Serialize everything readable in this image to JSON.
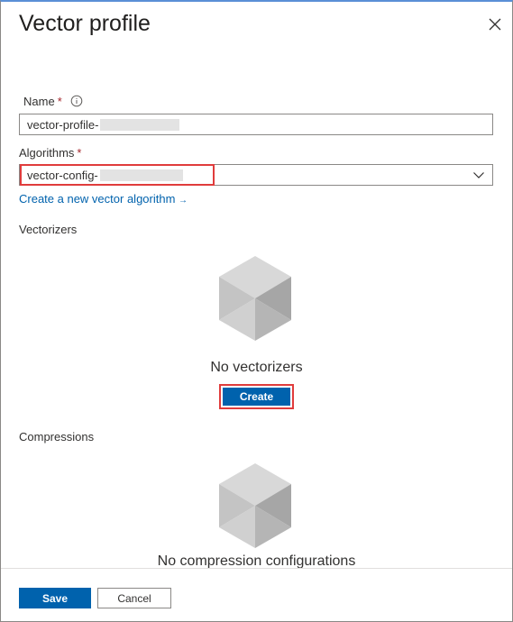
{
  "panel": {
    "title": "Vector profile",
    "close_icon": "close-icon"
  },
  "name_field": {
    "label": "Name",
    "required_mark": "*",
    "info_icon": "info-icon",
    "value": "vector-profile-"
  },
  "algorithms_field": {
    "label": "Algorithms",
    "required_mark": "*",
    "value": "vector-config-",
    "dropdown_icon": "chevron-down-icon"
  },
  "create_algorithm_link": {
    "label": "Create a new vector algorithm",
    "arrow": "→"
  },
  "vectorizers": {
    "section_label": "Vectorizers",
    "empty_icon": "cube-icon",
    "empty_text": "No vectorizers",
    "create_label": "Create"
  },
  "compressions": {
    "section_label": "Compressions",
    "empty_icon": "cube-icon",
    "empty_text": "No compression configurations"
  },
  "footer": {
    "save_label": "Save",
    "cancel_label": "Cancel"
  },
  "colors": {
    "accent": "#0062ad",
    "highlight": "#e03c3c",
    "required": "#a4262c",
    "link": "#0062ad"
  }
}
